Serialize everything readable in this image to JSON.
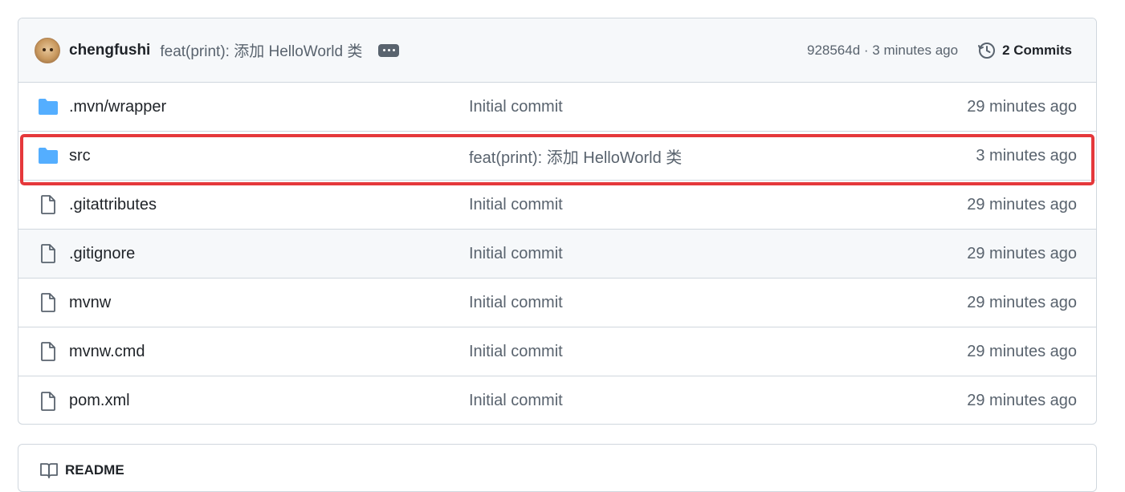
{
  "commit_header": {
    "author": "chengfushi",
    "message": "feat(print): 添加 HelloWorld 类",
    "sha_time": "928564d · 3 minutes ago",
    "commits_label": "2 Commits"
  },
  "files": [
    {
      "name": ".mvn/wrapper",
      "type": "folder",
      "commit": "Initial commit",
      "time": "29 minutes ago"
    },
    {
      "name": "src",
      "type": "folder",
      "commit": "feat(print): 添加 HelloWorld 类",
      "time": "3 minutes ago"
    },
    {
      "name": ".gitattributes",
      "type": "file",
      "commit": "Initial commit",
      "time": "29 minutes ago"
    },
    {
      "name": ".gitignore",
      "type": "file",
      "commit": "Initial commit",
      "time": "29 minutes ago"
    },
    {
      "name": "mvnw",
      "type": "file",
      "commit": "Initial commit",
      "time": "29 minutes ago"
    },
    {
      "name": "mvnw.cmd",
      "type": "file",
      "commit": "Initial commit",
      "time": "29 minutes ago"
    },
    {
      "name": "pom.xml",
      "type": "file",
      "commit": "Initial commit",
      "time": "29 minutes ago"
    }
  ],
  "readme": {
    "label": "README"
  },
  "icons": {
    "folder": "folder-icon",
    "file": "file-icon",
    "history": "history-icon",
    "ellipsis": "ellipsis-icon",
    "book": "book-icon"
  },
  "colors": {
    "folder": "#54aeff",
    "highlight": "#e5383b",
    "muted_text": "#59636e",
    "border": "#d0d7de"
  }
}
